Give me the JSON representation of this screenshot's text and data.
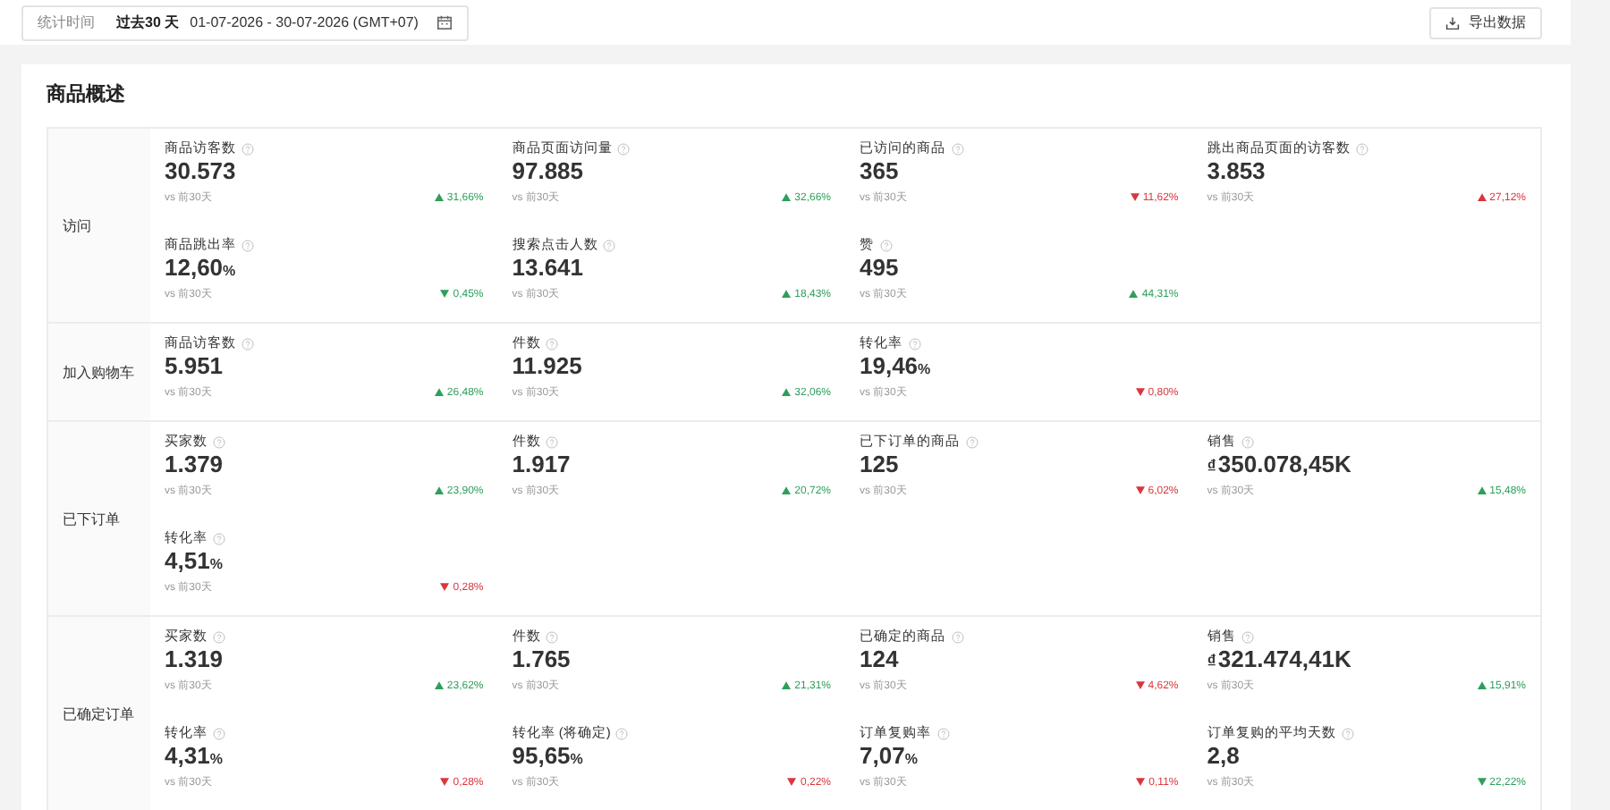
{
  "filter": {
    "label": "统计时间",
    "range": "过去30 天",
    "dates": "01-07-2026 - 30-07-2026 (GMT+07)"
  },
  "export_button": "导出数据",
  "section_title": "商品概述",
  "groups": [
    {
      "label": "访问",
      "metrics": [
        {
          "name": "商品访客数",
          "value": "30.573",
          "compare": "vs 前30天",
          "change": "31,66%",
          "up": true,
          "color": "#2e9e5b"
        },
        {
          "name": "商品页面访问量",
          "value": "97.885",
          "compare": "vs 前30天",
          "change": "32,66%",
          "up": true,
          "color": "#2e9e5b"
        },
        {
          "name": "已访问的商品",
          "value": "365",
          "compare": "vs 前30天",
          "change": "11,62%",
          "up": false,
          "color": "#d9363e"
        },
        {
          "name": "跳出商品页面的访客数",
          "value": "3.853",
          "compare": "vs 前30天",
          "change": "27,12%",
          "up": true,
          "color": "#d9363e"
        },
        {
          "name": "商品跳出率",
          "value": "12,60",
          "suffix": "%",
          "compare": "vs 前30天",
          "change": "0,45%",
          "up": false,
          "color": "#2e9e5b"
        },
        {
          "name": "搜索点击人数",
          "value": "13.641",
          "compare": "vs 前30天",
          "change": "18,43%",
          "up": true,
          "color": "#2e9e5b"
        },
        {
          "name": "赞",
          "value": "495",
          "compare": "vs 前30天",
          "change": "44,31%",
          "up": true,
          "color": "#2e9e5b"
        }
      ]
    },
    {
      "label": "加入购物车",
      "metrics": [
        {
          "name": "商品访客数",
          "value": "5.951",
          "compare": "vs 前30天",
          "change": "26,48%",
          "up": true,
          "color": "#2e9e5b"
        },
        {
          "name": "件数",
          "value": "11.925",
          "compare": "vs 前30天",
          "change": "32,06%",
          "up": true,
          "color": "#2e9e5b"
        },
        {
          "name": "转化率",
          "value": "19,46",
          "suffix": "%",
          "compare": "vs 前30天",
          "change": "0,80%",
          "up": false,
          "color": "#d9363e"
        }
      ]
    },
    {
      "label": "已下订单",
      "metrics": [
        {
          "name": "买家数",
          "value": "1.379",
          "compare": "vs 前30天",
          "change": "23,90%",
          "up": true,
          "color": "#2e9e5b"
        },
        {
          "name": "件数",
          "value": "1.917",
          "compare": "vs 前30天",
          "change": "20,72%",
          "up": true,
          "color": "#2e9e5b"
        },
        {
          "name": "已下订单的商品",
          "value": "125",
          "compare": "vs 前30天",
          "change": "6,02%",
          "up": false,
          "color": "#d9363e"
        },
        {
          "name": "销售",
          "prefix": "₫",
          "value": "350.078,45K",
          "compare": "vs 前30天",
          "change": "15,48%",
          "up": true,
          "color": "#2e9e5b"
        },
        {
          "name": "转化率",
          "value": "4,51",
          "suffix": "%",
          "compare": "vs 前30天",
          "change": "0,28%",
          "up": false,
          "color": "#d9363e"
        }
      ]
    },
    {
      "label": "已确定订单",
      "metrics": [
        {
          "name": "买家数",
          "value": "1.319",
          "compare": "vs 前30天",
          "change": "23,62%",
          "up": true,
          "color": "#2e9e5b"
        },
        {
          "name": "件数",
          "value": "1.765",
          "compare": "vs 前30天",
          "change": "21,31%",
          "up": true,
          "color": "#2e9e5b"
        },
        {
          "name": "已确定的商品",
          "value": "124",
          "compare": "vs 前30天",
          "change": "4,62%",
          "up": false,
          "color": "#d9363e"
        },
        {
          "name": "销售",
          "prefix": "₫",
          "value": "321.474,41K",
          "compare": "vs 前30天",
          "change": "15,91%",
          "up": true,
          "color": "#2e9e5b"
        },
        {
          "name": "转化率",
          "value": "4,31",
          "suffix": "%",
          "compare": "vs 前30天",
          "change": "0,28%",
          "up": false,
          "color": "#d9363e"
        },
        {
          "name": "转化率 (将确定)",
          "value": "95,65",
          "suffix": "%",
          "compare": "vs 前30天",
          "change": "0,22%",
          "up": false,
          "color": "#d9363e"
        },
        {
          "name": "订单复购率",
          "value": "7,07",
          "suffix": "%",
          "compare": "vs 前30天",
          "change": "0,11%",
          "up": false,
          "color": "#d9363e"
        },
        {
          "name": "订单复购的平均天数",
          "value": "2,8",
          "compare": "vs 前30天",
          "change": "22,22%",
          "up": false,
          "color": "#2e9e5b"
        }
      ]
    }
  ]
}
